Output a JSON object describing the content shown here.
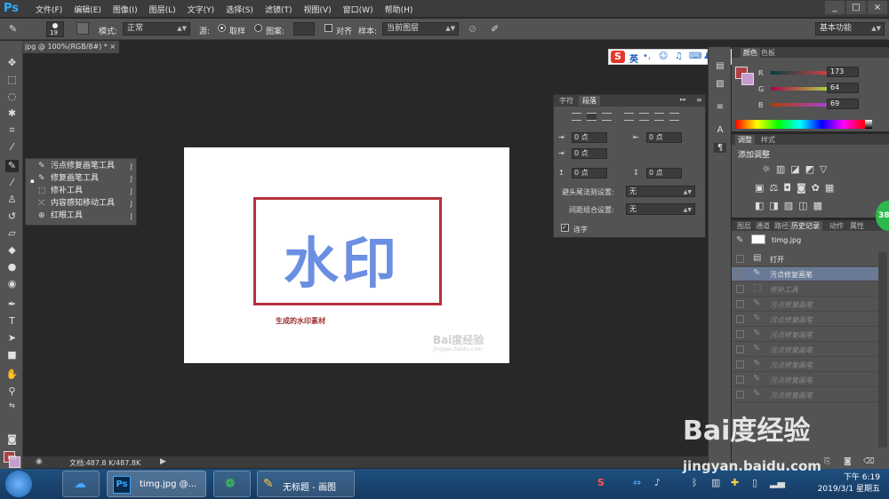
{
  "app": {
    "logo": "Ps",
    "menus": [
      "文件(F)",
      "编辑(E)",
      "图像(I)",
      "图层(L)",
      "文字(Y)",
      "选择(S)",
      "滤镜(T)",
      "视图(V)",
      "窗口(W)",
      "帮助(H)"
    ],
    "window_controls": [
      "_",
      "□",
      "×"
    ]
  },
  "options": {
    "brush_size": "19",
    "mode_label": "模式:",
    "mode_value": "正常",
    "source_label": "源:",
    "sample_radio": "取样",
    "pattern_radio": "图案:",
    "align_label": "对齐",
    "sample_label": "样本:",
    "sample_value": "当前图层",
    "workspace": "基本功能"
  },
  "doc_tab": "jpg @ 100%(RGB/8#) * ×",
  "flyout": {
    "items": [
      {
        "label": "污点修复画笔工具",
        "key": "J",
        "icon": "spot-healing-brush-icon",
        "glyph": "✎"
      },
      {
        "label": "修复画笔工具",
        "key": "J",
        "icon": "healing-brush-icon",
        "glyph": "✎",
        "selected": true
      },
      {
        "label": "修补工具",
        "key": "J",
        "icon": "patch-tool-icon",
        "glyph": "⬚"
      },
      {
        "label": "内容感知移动工具",
        "key": "J",
        "icon": "content-aware-move-icon",
        "glyph": "⤫"
      },
      {
        "label": "红眼工具",
        "key": "J",
        "icon": "red-eye-icon",
        "glyph": "⊕"
      }
    ]
  },
  "canvas": {
    "watermark_text": "水印",
    "caption": "生成的水印素材",
    "site_watermark": "Bai度经验",
    "site_url": "jingyan.baidu.com"
  },
  "paragraph_panel": {
    "tabs": [
      "字符",
      "段落"
    ],
    "indent_left": "0 点",
    "indent_right": "0 点",
    "indent_first": "0 点",
    "space_before": "0 点",
    "space_after": "0 点",
    "kinsoku_label": "避头尾法则设置:",
    "kinsoku_value": "无",
    "mojikumi_label": "间距组合设置:",
    "mojikumi_value": "无",
    "hyphenate_label": "连字"
  },
  "ime": {
    "logo": "S",
    "mode": "英"
  },
  "color_panel": {
    "tabs": [
      "颜色",
      "色板"
    ],
    "r_label": "R",
    "r_value": "173",
    "g_label": "G",
    "g_value": "64",
    "b_label": "B",
    "b_value": "69",
    "fg_color": "#ad4045"
  },
  "adjust_panel": {
    "tabs": [
      "调整",
      "样式"
    ],
    "title": "添加调整"
  },
  "history_panel": {
    "tabs": [
      "图层",
      "通道",
      "路径",
      "历史记录",
      "动作",
      "属性"
    ],
    "snapshot": "timg.jpg",
    "rows": [
      {
        "label": "打开",
        "dim": false
      },
      {
        "label": "污点修复画笔",
        "dim": false,
        "selected": true
      },
      {
        "label": "修补工具",
        "dim": true
      },
      {
        "label": "污点修复画笔",
        "dim": true
      },
      {
        "label": "污点修复画笔",
        "dim": true
      },
      {
        "label": "污点修复画笔",
        "dim": true
      },
      {
        "label": "污点修复画笔",
        "dim": true
      },
      {
        "label": "污点修复画笔",
        "dim": true
      },
      {
        "label": "污点修复画笔",
        "dim": true
      },
      {
        "label": "污点修复画笔",
        "dim": true
      }
    ]
  },
  "statusbar": {
    "doc_size": "文档:487.8 K/487.8K"
  },
  "taskbar": {
    "tasks": [
      "timg.jpg @...",
      "无标题 - 画图"
    ],
    "time": "下午 6:19",
    "date": "2019/3/1 星期五",
    "badge": "38"
  },
  "overlay": {
    "baidu": "Bai度经验",
    "url": "jingyan.baidu.com"
  }
}
